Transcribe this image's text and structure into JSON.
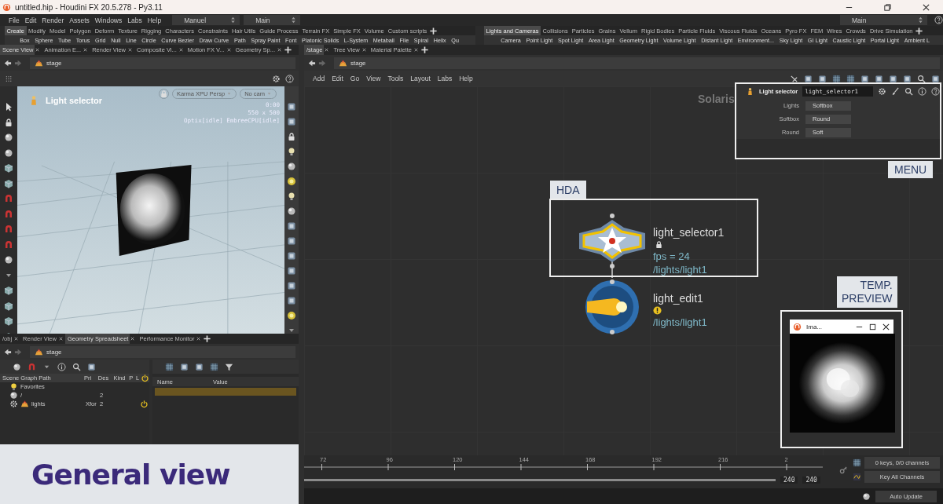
{
  "window": {
    "title": "untitled.hip - Houdini FX 20.5.278 - Py3.11"
  },
  "menu_bar": {
    "items": [
      "File",
      "Edit",
      "Render",
      "Assets",
      "Windows",
      "Labs",
      "Help"
    ],
    "desktop": "Manuel",
    "context": "Main",
    "right_context": "Main"
  },
  "shelves": [
    {
      "tabs": [
        {
          "label": "Create",
          "selected": true
        },
        {
          "label": "Modify",
          "selected": false
        },
        {
          "label": "Model",
          "selected": false
        },
        {
          "label": "Polygon",
          "selected": false
        },
        {
          "label": "Deform",
          "selected": false
        },
        {
          "label": "Texture",
          "selected": false
        },
        {
          "label": "Rigging",
          "selected": false
        },
        {
          "label": "Characters",
          "selected": false
        },
        {
          "label": "Constraints",
          "selected": false
        },
        {
          "label": "Hair Utils",
          "selected": false
        },
        {
          "label": "Guide Process",
          "selected": false
        },
        {
          "label": "Terrain FX",
          "selected": false
        },
        {
          "label": "Simple FX",
          "selected": false
        },
        {
          "label": "Volume",
          "selected": false
        },
        {
          "label": "Custom scripts",
          "selected": false
        }
      ],
      "tools": [
        "Box",
        "Sphere",
        "Tube",
        "Torus",
        "Grid",
        "Null",
        "Line",
        "Circle",
        "Curve Bezier",
        "Draw Curve",
        "Path",
        "Spray Paint",
        "Font",
        "Platonic Solids",
        "L-System",
        "Metaball",
        "File",
        "Spiral",
        "Helix",
        "Qu"
      ]
    },
    {
      "tabs": [
        {
          "label": "Lights and Cameras",
          "selected": true
        },
        {
          "label": "Collisions",
          "selected": false
        },
        {
          "label": "Particles",
          "selected": false
        },
        {
          "label": "Grains",
          "selected": false
        },
        {
          "label": "Vellum",
          "selected": false
        },
        {
          "label": "Rigid Bodies",
          "selected": false
        },
        {
          "label": "Particle Fluids",
          "selected": false
        },
        {
          "label": "Viscous Fluids",
          "selected": false
        },
        {
          "label": "Oceans",
          "selected": false
        },
        {
          "label": "Pyro FX",
          "selected": false
        },
        {
          "label": "FEM",
          "selected": false
        },
        {
          "label": "Wires",
          "selected": false
        },
        {
          "label": "Crowds",
          "selected": false
        },
        {
          "label": "Drive Simulation",
          "selected": false
        }
      ],
      "tools": [
        "Camera",
        "Point Light",
        "Spot Light",
        "Area Light",
        "Geometry Light",
        "Volume Light",
        "Distant Light",
        "Environment...",
        "Sky Light",
        "GI Light",
        "Caustic Light",
        "Portal Light",
        "Ambient L"
      ]
    }
  ],
  "scene_view": {
    "tabs": [
      {
        "label": "Scene View",
        "selected": true
      },
      {
        "label": "Animation E...",
        "selected": false
      },
      {
        "label": "Render View",
        "selected": false
      },
      {
        "label": "Composite Vi...",
        "selected": false
      },
      {
        "label": "Motion FX V...",
        "selected": false
      },
      {
        "label": "Geometry Sp...",
        "selected": false
      }
    ],
    "path": "stage",
    "viewport": {
      "title": "Light selector",
      "renderer": "Karma XPU Persp",
      "camera": "No cam",
      "stats": [
        "0:00",
        "550 x 500",
        "Optix[idle] EmbreeCPU[idle]"
      ]
    }
  },
  "spreadsheet": {
    "tabs": [
      {
        "label": "/obj",
        "selected": false
      },
      {
        "label": "Render View",
        "selected": false
      },
      {
        "label": "Geometry Spreadsheet",
        "selected": true
      },
      {
        "label": "Performance Monitor",
        "selected": false
      }
    ],
    "path": "stage",
    "scene_graph": {
      "columns": [
        "Scene Graph Path",
        "Pri",
        "Des",
        "Kind",
        "P",
        "L"
      ],
      "rows": [
        {
          "name": "Favorites",
          "kind": "favorites"
        },
        {
          "name": "/",
          "kind": "root",
          "des": "2",
          "children": [
            {
              "name": "lights",
              "kind": "xform",
              "pri": "Xfor",
              "des": "2",
              "active": true
            }
          ]
        }
      ]
    },
    "attributes": {
      "columns": [
        "Name",
        "Value"
      ]
    }
  },
  "network": {
    "tabs": [
      {
        "label": "/stage",
        "selected": true
      },
      {
        "label": "Tree View",
        "selected": false
      },
      {
        "label": "Material Palette",
        "selected": false
      }
    ],
    "path": "stage",
    "menu": [
      "Add",
      "Edit",
      "Go",
      "View",
      "Tools",
      "Layout",
      "Labs",
      "Help"
    ],
    "context_label": "Solaris",
    "nodes": [
      {
        "name": "light_selector1",
        "kind": "selector",
        "locked": true,
        "info": "fps = 24",
        "output": "/lights/light1"
      },
      {
        "name": "light_edit1",
        "kind": "edit",
        "warning": true,
        "output": "/lights/light1"
      }
    ]
  },
  "parameters": {
    "type_label": "Light selector",
    "node_name": "light_selector1",
    "rows": [
      {
        "label": "Lights",
        "value": "Softbox"
      },
      {
        "label": "Softbox",
        "value": "Round"
      },
      {
        "label": "Round",
        "value": "Soft"
      }
    ]
  },
  "preview_window": {
    "title": "Ima..."
  },
  "callouts": {
    "hda": "HDA",
    "menu": "MENU",
    "preview": [
      "TEMP.",
      "PREVIEW"
    ],
    "general": "General view"
  },
  "timeline": {
    "level": 1,
    "ticks": [
      "72",
      "96",
      "120",
      "144",
      "168",
      "192",
      "216",
      "2"
    ],
    "end_frame": "240",
    "range_end": "240",
    "keys_status": "0 keys, 0/0 channels",
    "key_button": "Key All Channels"
  },
  "status_bar": {
    "update_mode": "Auto Update"
  }
}
